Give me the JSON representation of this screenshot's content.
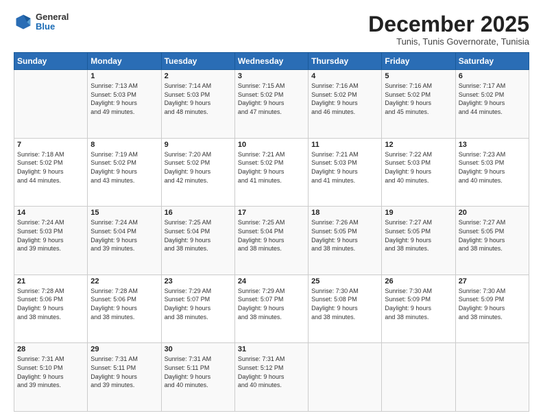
{
  "header": {
    "logo_general": "General",
    "logo_blue": "Blue",
    "title": "December 2025",
    "subtitle": "Tunis, Tunis Governorate, Tunisia"
  },
  "days_of_week": [
    "Sunday",
    "Monday",
    "Tuesday",
    "Wednesday",
    "Thursday",
    "Friday",
    "Saturday"
  ],
  "weeks": [
    [
      {
        "day": "",
        "info": ""
      },
      {
        "day": "1",
        "info": "Sunrise: 7:13 AM\nSunset: 5:03 PM\nDaylight: 9 hours\nand 49 minutes."
      },
      {
        "day": "2",
        "info": "Sunrise: 7:14 AM\nSunset: 5:03 PM\nDaylight: 9 hours\nand 48 minutes."
      },
      {
        "day": "3",
        "info": "Sunrise: 7:15 AM\nSunset: 5:02 PM\nDaylight: 9 hours\nand 47 minutes."
      },
      {
        "day": "4",
        "info": "Sunrise: 7:16 AM\nSunset: 5:02 PM\nDaylight: 9 hours\nand 46 minutes."
      },
      {
        "day": "5",
        "info": "Sunrise: 7:16 AM\nSunset: 5:02 PM\nDaylight: 9 hours\nand 45 minutes."
      },
      {
        "day": "6",
        "info": "Sunrise: 7:17 AM\nSunset: 5:02 PM\nDaylight: 9 hours\nand 44 minutes."
      }
    ],
    [
      {
        "day": "7",
        "info": "Sunrise: 7:18 AM\nSunset: 5:02 PM\nDaylight: 9 hours\nand 44 minutes."
      },
      {
        "day": "8",
        "info": "Sunrise: 7:19 AM\nSunset: 5:02 PM\nDaylight: 9 hours\nand 43 minutes."
      },
      {
        "day": "9",
        "info": "Sunrise: 7:20 AM\nSunset: 5:02 PM\nDaylight: 9 hours\nand 42 minutes."
      },
      {
        "day": "10",
        "info": "Sunrise: 7:21 AM\nSunset: 5:02 PM\nDaylight: 9 hours\nand 41 minutes."
      },
      {
        "day": "11",
        "info": "Sunrise: 7:21 AM\nSunset: 5:03 PM\nDaylight: 9 hours\nand 41 minutes."
      },
      {
        "day": "12",
        "info": "Sunrise: 7:22 AM\nSunset: 5:03 PM\nDaylight: 9 hours\nand 40 minutes."
      },
      {
        "day": "13",
        "info": "Sunrise: 7:23 AM\nSunset: 5:03 PM\nDaylight: 9 hours\nand 40 minutes."
      }
    ],
    [
      {
        "day": "14",
        "info": "Sunrise: 7:24 AM\nSunset: 5:03 PM\nDaylight: 9 hours\nand 39 minutes."
      },
      {
        "day": "15",
        "info": "Sunrise: 7:24 AM\nSunset: 5:04 PM\nDaylight: 9 hours\nand 39 minutes."
      },
      {
        "day": "16",
        "info": "Sunrise: 7:25 AM\nSunset: 5:04 PM\nDaylight: 9 hours\nand 38 minutes."
      },
      {
        "day": "17",
        "info": "Sunrise: 7:25 AM\nSunset: 5:04 PM\nDaylight: 9 hours\nand 38 minutes."
      },
      {
        "day": "18",
        "info": "Sunrise: 7:26 AM\nSunset: 5:05 PM\nDaylight: 9 hours\nand 38 minutes."
      },
      {
        "day": "19",
        "info": "Sunrise: 7:27 AM\nSunset: 5:05 PM\nDaylight: 9 hours\nand 38 minutes."
      },
      {
        "day": "20",
        "info": "Sunrise: 7:27 AM\nSunset: 5:05 PM\nDaylight: 9 hours\nand 38 minutes."
      }
    ],
    [
      {
        "day": "21",
        "info": "Sunrise: 7:28 AM\nSunset: 5:06 PM\nDaylight: 9 hours\nand 38 minutes."
      },
      {
        "day": "22",
        "info": "Sunrise: 7:28 AM\nSunset: 5:06 PM\nDaylight: 9 hours\nand 38 minutes."
      },
      {
        "day": "23",
        "info": "Sunrise: 7:29 AM\nSunset: 5:07 PM\nDaylight: 9 hours\nand 38 minutes."
      },
      {
        "day": "24",
        "info": "Sunrise: 7:29 AM\nSunset: 5:07 PM\nDaylight: 9 hours\nand 38 minutes."
      },
      {
        "day": "25",
        "info": "Sunrise: 7:30 AM\nSunset: 5:08 PM\nDaylight: 9 hours\nand 38 minutes."
      },
      {
        "day": "26",
        "info": "Sunrise: 7:30 AM\nSunset: 5:09 PM\nDaylight: 9 hours\nand 38 minutes."
      },
      {
        "day": "27",
        "info": "Sunrise: 7:30 AM\nSunset: 5:09 PM\nDaylight: 9 hours\nand 38 minutes."
      }
    ],
    [
      {
        "day": "28",
        "info": "Sunrise: 7:31 AM\nSunset: 5:10 PM\nDaylight: 9 hours\nand 39 minutes."
      },
      {
        "day": "29",
        "info": "Sunrise: 7:31 AM\nSunset: 5:11 PM\nDaylight: 9 hours\nand 39 minutes."
      },
      {
        "day": "30",
        "info": "Sunrise: 7:31 AM\nSunset: 5:11 PM\nDaylight: 9 hours\nand 40 minutes."
      },
      {
        "day": "31",
        "info": "Sunrise: 7:31 AM\nSunset: 5:12 PM\nDaylight: 9 hours\nand 40 minutes."
      },
      {
        "day": "",
        "info": ""
      },
      {
        "day": "",
        "info": ""
      },
      {
        "day": "",
        "info": ""
      }
    ]
  ]
}
